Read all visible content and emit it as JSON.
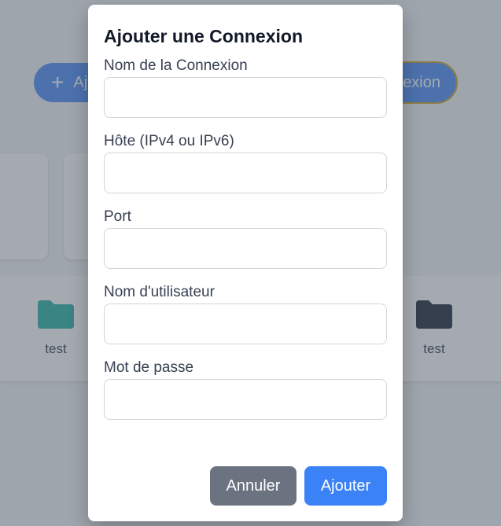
{
  "background": {
    "add_button_label": "Aj",
    "connexion_button_label": "exion",
    "folders": [
      {
        "label": "test",
        "color": "#2bb3a5"
      },
      {
        "label": "test",
        "color": "#1f2937"
      }
    ]
  },
  "modal": {
    "title": "Ajouter une Connexion",
    "fields": [
      {
        "label": "Nom de la Connexion",
        "value": "",
        "placeholder": ""
      },
      {
        "label": "Hôte (IPv4 ou IPv6)",
        "value": "",
        "placeholder": ""
      },
      {
        "label": "Port",
        "value": "",
        "placeholder": ""
      },
      {
        "label": "Nom d'utilisateur",
        "value": "",
        "placeholder": ""
      },
      {
        "label": "Mot de passe",
        "value": "",
        "placeholder": ""
      }
    ],
    "cancel_label": "Annuler",
    "submit_label": "Ajouter"
  },
  "colors": {
    "primary": "#3b82f6",
    "secondary": "#6b7280",
    "overlay": "rgba(75,85,99,0.5)"
  }
}
